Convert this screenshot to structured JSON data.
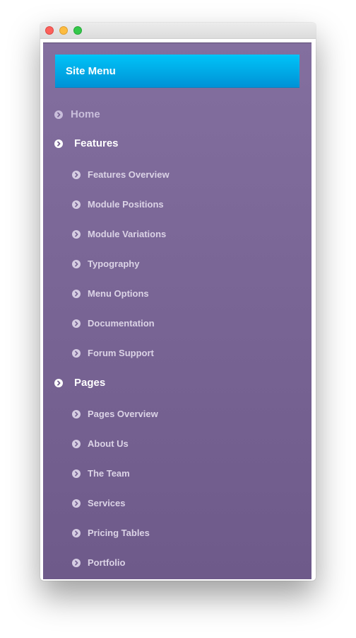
{
  "header": {
    "title": "Site Menu"
  },
  "colors": {
    "panel_top": "#836f9f",
    "panel_bottom": "#6e5a8a",
    "header_accent": "#00b4ee",
    "active_text": "#ffffff",
    "item_text": "#dbd3e6"
  },
  "menu": {
    "items": [
      {
        "label": "Home",
        "level": 1,
        "style": "muted",
        "icon": "chevron-circle-right-icon"
      },
      {
        "label": "Features",
        "level": 1,
        "style": "white",
        "icon": "chevron-circle-right-icon"
      },
      {
        "label": "Features Overview",
        "level": 2,
        "icon": "chevron-circle-right-icon"
      },
      {
        "label": "Module Positions",
        "level": 2,
        "icon": "chevron-circle-right-icon"
      },
      {
        "label": "Module Variations",
        "level": 2,
        "icon": "chevron-circle-right-icon"
      },
      {
        "label": "Typography",
        "level": 2,
        "icon": "chevron-circle-right-icon"
      },
      {
        "label": "Menu Options",
        "level": 2,
        "icon": "chevron-circle-right-icon"
      },
      {
        "label": "Documentation",
        "level": 2,
        "icon": "chevron-circle-right-icon"
      },
      {
        "label": "Forum Support",
        "level": 2,
        "icon": "chevron-circle-right-icon"
      },
      {
        "label": "Pages",
        "level": 1,
        "style": "white",
        "icon": "chevron-circle-right-icon"
      },
      {
        "label": "Pages Overview",
        "level": 2,
        "icon": "chevron-circle-right-icon"
      },
      {
        "label": "About Us",
        "level": 2,
        "icon": "chevron-circle-right-icon"
      },
      {
        "label": "The Team",
        "level": 2,
        "icon": "chevron-circle-right-icon"
      },
      {
        "label": "Services",
        "level": 2,
        "icon": "chevron-circle-right-icon"
      },
      {
        "label": "Pricing Tables",
        "level": 2,
        "icon": "chevron-circle-right-icon"
      },
      {
        "label": "Portfolio",
        "level": 2,
        "icon": "chevron-circle-right-icon"
      }
    ]
  }
}
